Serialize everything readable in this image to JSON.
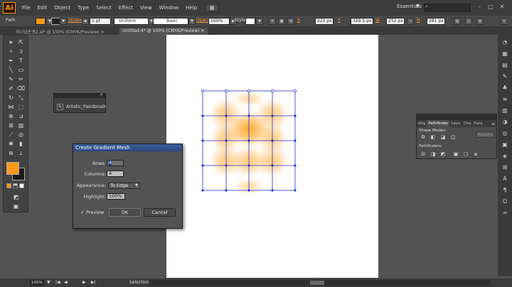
{
  "menubar": {
    "logo": "Ai",
    "items": [
      "File",
      "Edit",
      "Object",
      "Type",
      "Select",
      "Effect",
      "View",
      "Window",
      "Help"
    ],
    "workspace": "Essentials"
  },
  "control_bar": {
    "selection_label": "Path",
    "fill_color": "#ff9a1a",
    "stroke_label": "Stroke",
    "stroke_weight": "1 pt",
    "profile_label": "Uniform",
    "brush_label": "Basic",
    "opacity_label": "Opacity",
    "opacity_value": "100%",
    "style_label": "Style",
    "x_label": "X",
    "x_value": "223 px",
    "y_label": "Y",
    "y_value": "329.5 px",
    "w_label": "W",
    "w_value": "252 px",
    "h_label": "H",
    "h_value": "281 px"
  },
  "tabs": [
    {
      "label": "리니딩손생2.ai* @ 150% (CMYK/Preview)"
    },
    {
      "label": "Untitled-4* @ 100% (CMYK/Preview)"
    }
  ],
  "brush_panel": {
    "brush_name": "Artistic_Paintbrush"
  },
  "gradient_mesh_dialog": {
    "title": "Create Gradient Mesh",
    "rows_label": "Rows:",
    "rows_value": "4",
    "columns_label": "Columns:",
    "columns_value": "4",
    "appearance_label": "Appearance:",
    "appearance_value": "To Edge",
    "highlight_label": "Highlight:",
    "highlight_value": "100%",
    "preview_label": "Preview",
    "preview_checked": true,
    "ok_label": "OK",
    "cancel_label": "Cancel"
  },
  "pathfinder_panel": {
    "tabs": [
      "Alig",
      "Pathfinder",
      "Laye",
      "Cha",
      "Para"
    ],
    "active_tab": "Pathfinder",
    "shape_modes_label": "Shape Modes:",
    "expand_label": "Expand",
    "pathfinders_label": "Pathfinders:"
  },
  "status_bar": {
    "zoom": "100%",
    "tool_status": "Selection"
  },
  "colors": {
    "accent": "#ff9a1a",
    "mesh_line": "#2233cc",
    "mesh_glow": "#ff9800"
  }
}
